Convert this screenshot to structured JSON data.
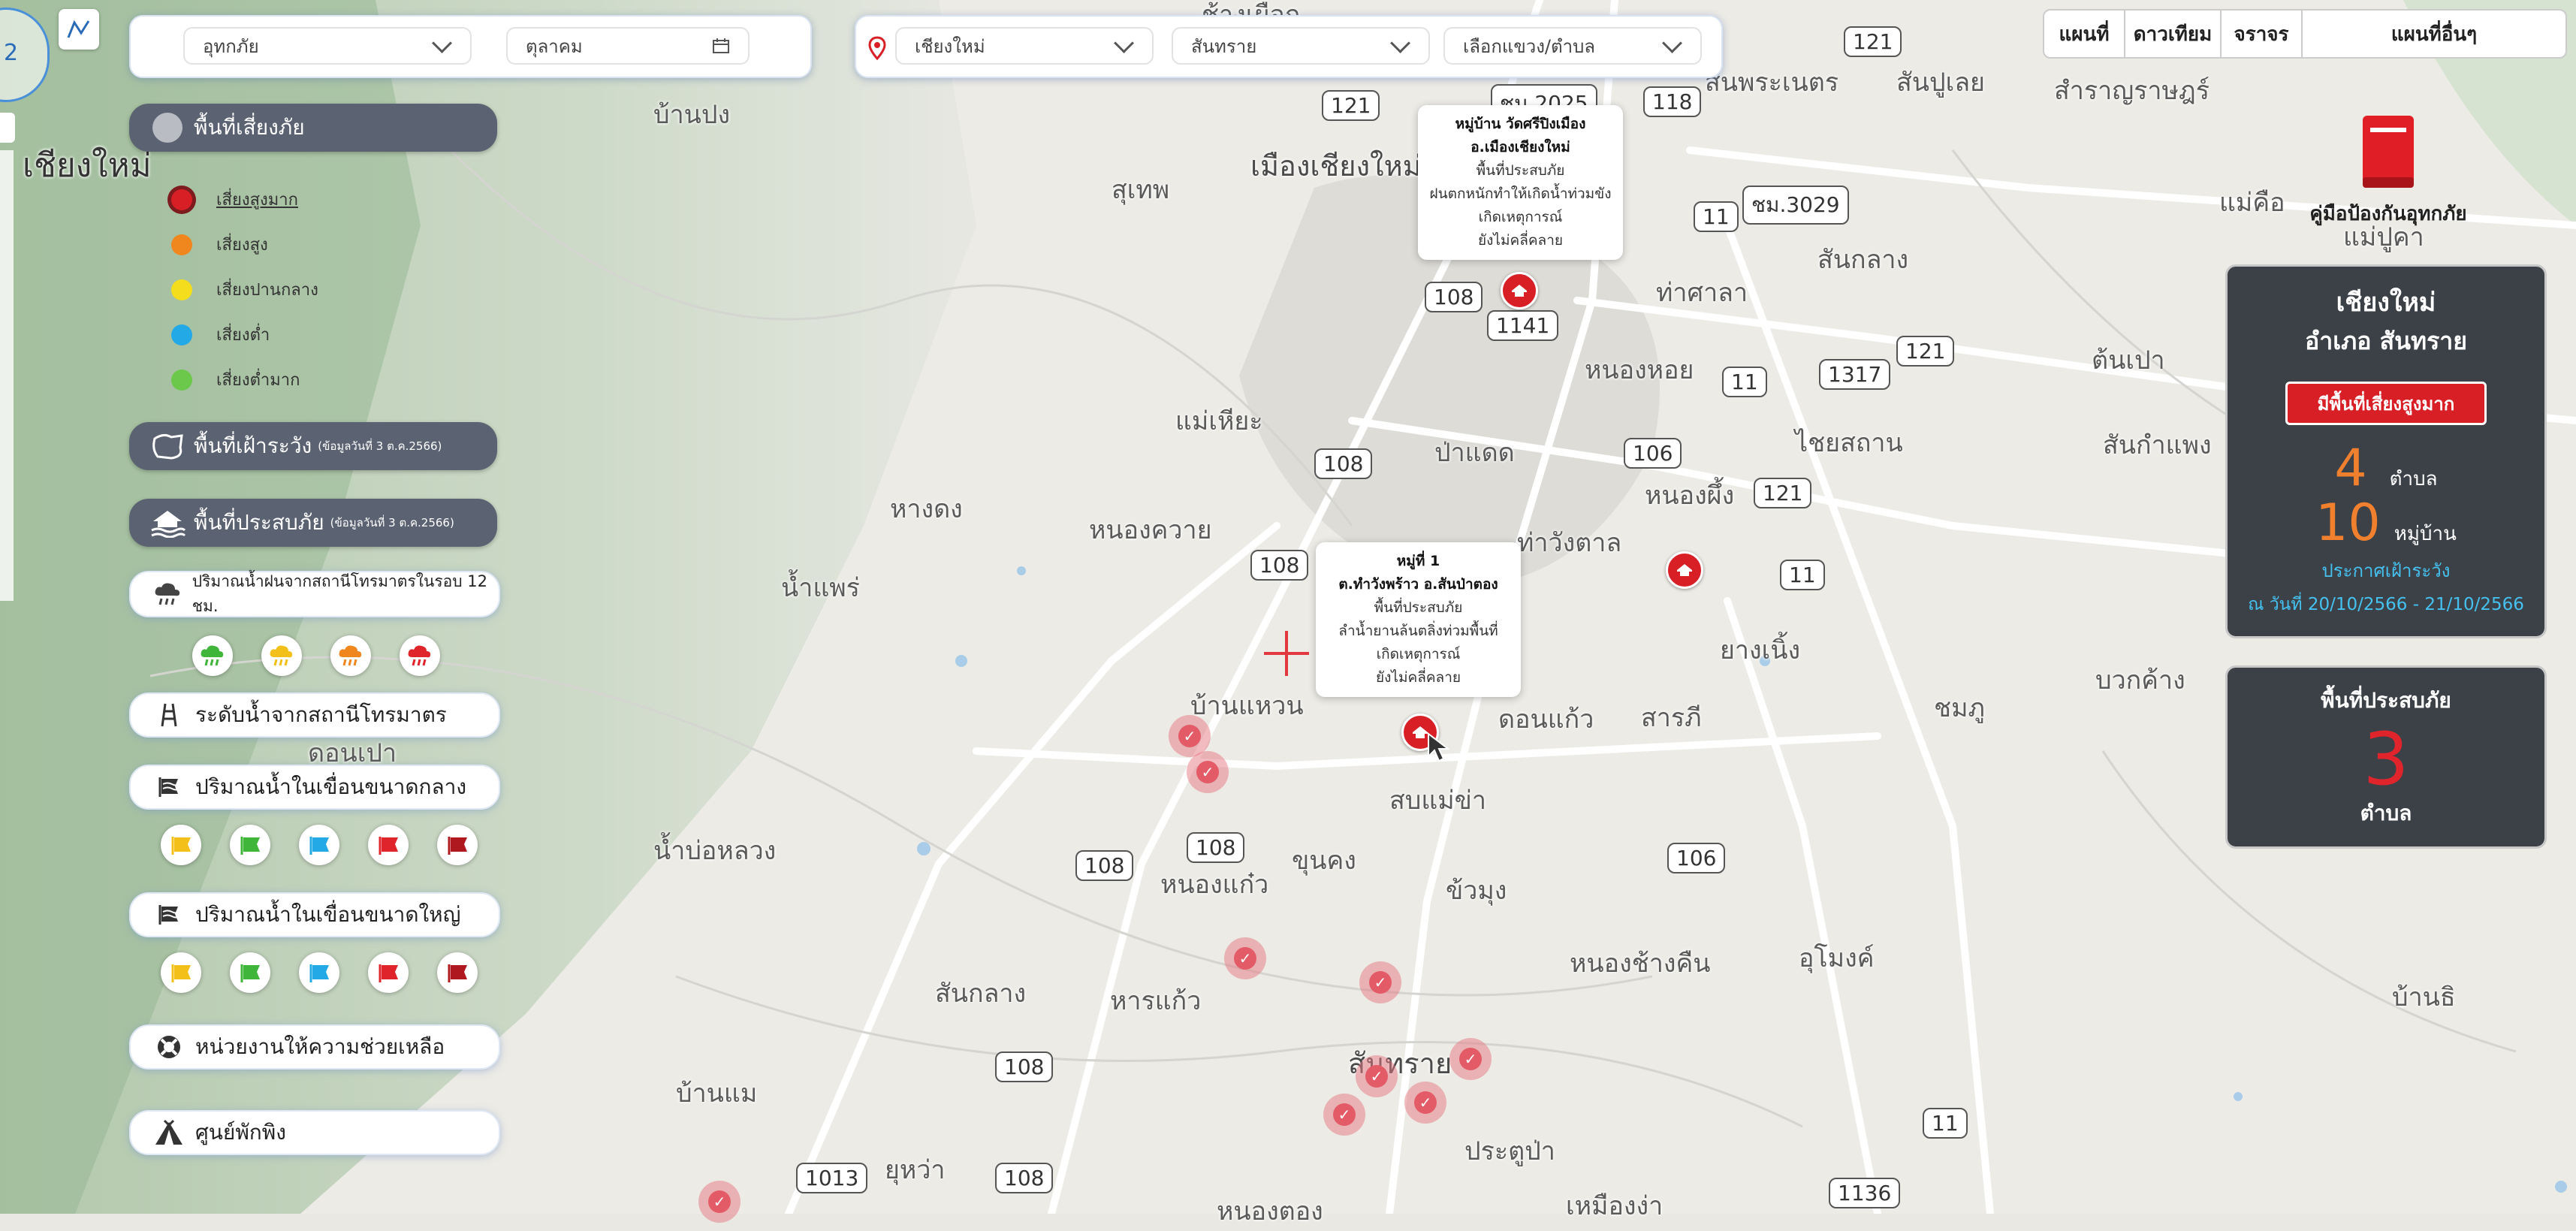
{
  "filters": {
    "disaster_type": "อุทกภัย",
    "month": "ตุลาคม",
    "province": "เชียงใหม่",
    "district": "สันทราย",
    "subdistrict_placeholder": "เลือกแขวง/ตำบล"
  },
  "map_tabs": [
    "แผนที่",
    "ดาวเทียม",
    "จราจร",
    "แผนที่อื่นๆ"
  ],
  "sidebar": {
    "risk_area": {
      "label": "พื้นที่เสี่ยงภัย"
    },
    "legend": [
      {
        "label": "เสี่ยงสูงมาก",
        "color": "#d81f26"
      },
      {
        "label": "เสี่ยงสูง",
        "color": "#f0861e"
      },
      {
        "label": "เสี่ยงปานกลาง",
        "color": "#f4dd1c"
      },
      {
        "label": "เสี่ยงต่ำ",
        "color": "#23a9e6"
      },
      {
        "label": "เสี่ยงต่ำมาก",
        "color": "#6bc84a"
      }
    ],
    "watch_area": {
      "label": "พื้นที่เฝ้าระวัง",
      "note": "(ข้อมูลวันที่ 3 ต.ค.2566)"
    },
    "flood_area": {
      "label": "พื้นที่ประสบภัย",
      "note": "(ข้อมูลวันที่ 3 ต.ค.2566)"
    },
    "rainfall": {
      "label": "ปริมาณน้ำฝนจากสถานีโทรมาตรในรอบ 12 ชม."
    },
    "water_level": {
      "label": "ระดับน้ำจากสถานีโทรมาตร"
    },
    "medium_dam": {
      "label": "ปริมาณน้ำในเขื่อนขนาดกลาง"
    },
    "large_dam": {
      "label": "ปริมาณน้ำในเขื่อนขนาดใหญ่"
    },
    "rescue": {
      "label": "หน่วยงานให้ความช่วยเหลือ"
    },
    "shelter": {
      "label": "ศูนย์พักพิง"
    }
  },
  "handbook": {
    "label": "คู่มือป้องกันอุทกภัย"
  },
  "summary": {
    "province": "เชียงใหม่",
    "district": "อำเภอ สันทราย",
    "badge": "มีพื้นที่เสี่ยงสูงมาก",
    "tambon_count": "4",
    "tambon_unit": "ตำบล",
    "village_count": "10",
    "village_unit": "หมู่บ้าน",
    "watch_label": "ประกาศเฝ้าระวัง",
    "watch_dates": "ณ วันที่ 20/10/2566 - 21/10/2566"
  },
  "flood_panel": {
    "title": "พื้นที่ประสบภัย",
    "count": "3",
    "unit": "ตำบล"
  },
  "popups": [
    {
      "title1": "หมู่บ้าน วัดศรีปิงเมือง",
      "title2": "อ.เมืองเชียงใหม่",
      "lines": [
        "พื้นที่ประสบภัย",
        "ฝนตกหนักทำให้เกิดน้ำท่วมขัง",
        "เกิดเหตุการณ์",
        "ยังไม่คลี่คลาย"
      ]
    },
    {
      "title1": "หมู่ที่ 1",
      "title2": "ต.ทำวังพร้าว อ.สันป่าตอง",
      "lines": [
        "พื้นที่ประสบภัย",
        "ลำน้ำยานล้นตลิ่งท่วมพื้นที่",
        "เกิดเหตุการณ์",
        "ยังไม่คลี่คลาย"
      ]
    }
  ],
  "map_labels": [
    "เชียงใหม่",
    "บ้านปง",
    "สุเทพ",
    "เมืองเชียงใหม่",
    "สันพระเนตร",
    "สันปูเลย",
    "สำราญราษฎร์",
    "แม่คือ",
    "แม่ปูคา",
    "สันกลาง",
    "ท่าศาลา",
    "หนองหอย",
    "ต้นเปา",
    "แม่เหียะ",
    "ป่าแดด",
    "ไชยสถาน",
    "สันกำแพง",
    "หางดง",
    "หนองควาย",
    "หนองผึ้ง",
    "ท่าวังตาล",
    "น้ำแพร่",
    "ยางเนิ้ง",
    "บวกค้าง",
    "บ้านแหวน",
    "ดอนแก้ว",
    "สารภี",
    "ชมภู",
    "ดอนเปา",
    "สบแม่ข่า",
    "น้ำบ่อหลวง",
    "หนองแก๋ว",
    "ขุนคง",
    "ข้วมุง",
    "หนองช้างคืน",
    "อุโมงค์",
    "บ้านธิ",
    "สันกลาง",
    "หารแก้ว",
    "สันทราย",
    "บ้านแม",
    "ประตูป่า",
    "ยุหว่า",
    "หนองตอง",
    "เหมืองง่า",
    "ช้างเผือก"
  ],
  "road_badges": [
    "121",
    "118",
    "ชม.2025",
    "121",
    "108",
    "1141",
    "11",
    "ชม.3029",
    "121",
    "1317",
    "11",
    "106",
    "121",
    "108",
    "108",
    "11",
    "108",
    "106",
    "108",
    "108",
    "1013",
    "108",
    "1136",
    "11"
  ],
  "zoom_indicator": "2"
}
